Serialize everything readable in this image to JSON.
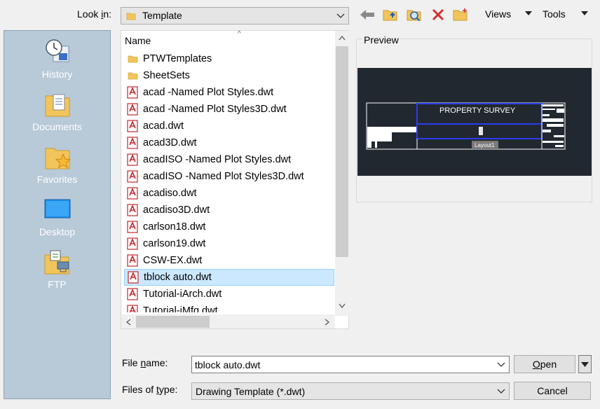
{
  "lookin": {
    "label_pre": "Look ",
    "label_u": "i",
    "label_post": "n:",
    "value": "Template"
  },
  "toolbar": {
    "back_icon": "back-arrow-icon",
    "up_icon": "up-folder-icon",
    "search_icon": "search-web-icon",
    "delete_icon": "delete-icon",
    "newfolder_icon": "new-folder-icon",
    "views_label": "Views",
    "tools_label": "Tools"
  },
  "places": [
    {
      "label": "History",
      "icon": "history-icon"
    },
    {
      "label": "Documents",
      "icon": "documents-icon"
    },
    {
      "label": "Favorites",
      "icon": "favorites-icon"
    },
    {
      "label": "Desktop",
      "icon": "desktop-icon"
    },
    {
      "label": "FTP",
      "icon": "ftp-icon"
    }
  ],
  "filelist": {
    "header": "Name",
    "rows": [
      {
        "name": "PTWTemplates",
        "type": "folder"
      },
      {
        "name": "SheetSets",
        "type": "folder"
      },
      {
        "name": "acad -Named Plot Styles.dwt",
        "type": "dwt"
      },
      {
        "name": "acad -Named Plot Styles3D.dwt",
        "type": "dwt"
      },
      {
        "name": "acad.dwt",
        "type": "dwt"
      },
      {
        "name": "acad3D.dwt",
        "type": "dwt"
      },
      {
        "name": "acadISO -Named Plot Styles.dwt",
        "type": "dwt"
      },
      {
        "name": "acadISO -Named Plot Styles3D.dwt",
        "type": "dwt"
      },
      {
        "name": "acadiso.dwt",
        "type": "dwt"
      },
      {
        "name": "acadiso3D.dwt",
        "type": "dwt"
      },
      {
        "name": "carlson18.dwt",
        "type": "dwt"
      },
      {
        "name": "carlson19.dwt",
        "type": "dwt"
      },
      {
        "name": "CSW-EX.dwt",
        "type": "dwt"
      },
      {
        "name": "tblock auto.dwt",
        "type": "dwt",
        "selected": true
      },
      {
        "name": "Tutorial-iArch.dwt",
        "type": "dwt"
      },
      {
        "name": "Tutorial-iMfg.dwt",
        "type": "dwt"
      }
    ]
  },
  "preview": {
    "label": "Preview",
    "title_text": "PROPERTY SURVEY",
    "tab_text": "Layout1"
  },
  "filename": {
    "label_pre": "File ",
    "label_u": "n",
    "label_post": "ame:",
    "value": "tblock auto.dwt"
  },
  "filetype": {
    "label_pre": "Files of ",
    "label_u": "t",
    "label_post": "ype:",
    "value": "Drawing Template (*.dwt)"
  },
  "buttons": {
    "open_u": "O",
    "open_rest": "pen",
    "cancel": "Cancel"
  },
  "colors": {
    "places_bg": "#b8c9d8",
    "selection": "#cce8ff",
    "preview_bg": "#212830",
    "dwt_icon": "#c0282d"
  }
}
